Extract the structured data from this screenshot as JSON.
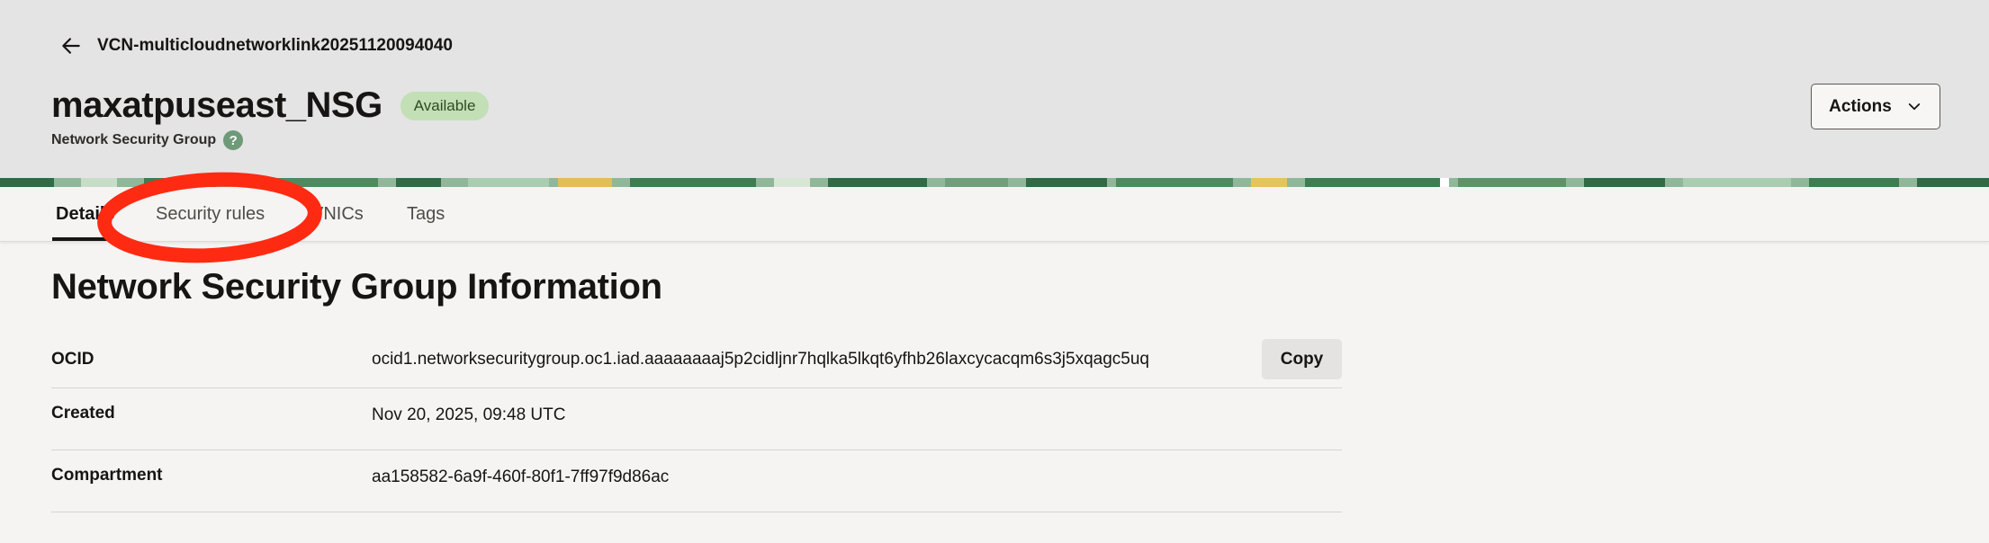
{
  "header": {
    "back_label": "VCN-multicloudnetworklink20251120094040",
    "title": "maxatpuseast_NSG",
    "status": "Available",
    "subtitle": "Network Security Group",
    "help_glyph": "?",
    "actions_label": "Actions"
  },
  "tabs": [
    {
      "label": "Details",
      "active": true
    },
    {
      "label": "Security rules",
      "active": false
    },
    {
      "label": "VNICs",
      "active": false
    },
    {
      "label": "Tags",
      "active": false
    }
  ],
  "section": {
    "title": "Network Security Group Information"
  },
  "info_rows": [
    {
      "label": "OCID",
      "value": "ocid1.networksecuritygroup.oc1.iad.aaaaaaaaj5p2cidljnr7hqlka5lkqt6yfhb26laxcycacqm6s3j5xqagc5uq",
      "action_label": "Copy"
    },
    {
      "label": "Created",
      "value": "Nov 20, 2025, 09:48 UTC"
    },
    {
      "label": "Compartment",
      "value": "aa158582-6a9f-460f-80f1-7ff97f9d86ac"
    }
  ],
  "icons": {
    "back": "arrow-left-icon",
    "actions": "chevron-down-icon",
    "help": "help-icon"
  },
  "colors": {
    "header_bg": "#e4e4e4",
    "badge_bg": "#c2dfb6",
    "badge_text": "#2d4c1f",
    "annotation": "#ff2a12",
    "page_bg": "#f5f4f2"
  }
}
